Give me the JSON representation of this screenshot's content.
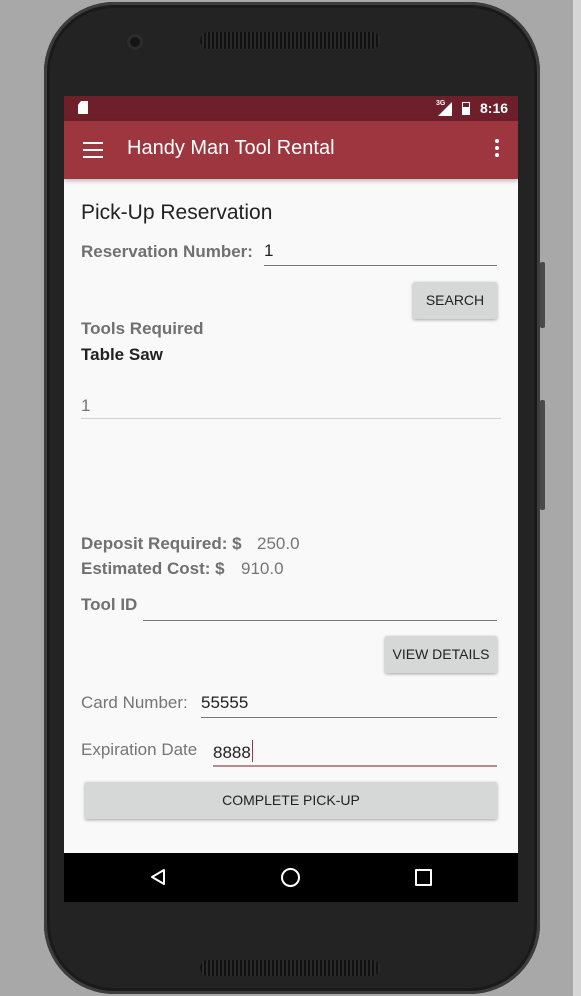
{
  "statusbar": {
    "network": "3G",
    "time": "8:16"
  },
  "appbar": {
    "title": "Handy Man Tool Rental"
  },
  "form": {
    "heading": "Pick-Up Reservation",
    "reservation_label": "Reservation Number:",
    "reservation_value": "1",
    "search_label": "SEARCH",
    "tools_required_label": "Tools Required",
    "tool_name": "Table Saw",
    "quantity_value": "1",
    "deposit_label": "Deposit Required: $",
    "deposit_value": "250.0",
    "estimated_label": "Estimated Cost: $",
    "estimated_value": "910.0",
    "tool_id_label": "Tool ID",
    "tool_id_value": "",
    "view_details_label": "VIEW DETAILS",
    "card_label": "Card Number:",
    "card_value": "55555",
    "expiration_label": "Expiration Date",
    "expiration_value": "8888",
    "complete_label": "COMPLETE PICK-UP"
  },
  "icons": {
    "menu": "hamburger-menu-icon",
    "overflow": "more-vert-icon",
    "back": "nav-back-icon",
    "home": "nav-home-icon",
    "recents": "nav-recents-icon"
  },
  "colors": {
    "status_bar": "#6e1f29",
    "app_bar": "#9e3640",
    "button": "#d6d7d7",
    "screen_bg": "#f9f9f9"
  }
}
